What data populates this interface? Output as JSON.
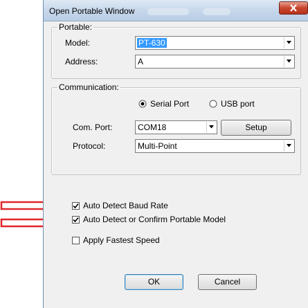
{
  "window": {
    "title": "Open Portable Window",
    "close_glyph": "x"
  },
  "portable": {
    "group_label": "Portable:",
    "model_label": "Model:",
    "model_value": "PT-630",
    "address_label": "Address:",
    "address_value": "A"
  },
  "communication": {
    "group_label": "Communication:",
    "serial_label": "Serial Port",
    "usb_label": "USB port",
    "serial_selected": true,
    "com_port_label": "Com. Port:",
    "com_port_value": "COM18",
    "setup_label": "Setup",
    "protocol_label": "Protocol:",
    "protocol_value": "Multi-Point"
  },
  "options": [
    {
      "label": "Auto Detect Baud Rate",
      "checked": true
    },
    {
      "label": "Auto Detect or Confirm Portable Model",
      "checked": true
    },
    {
      "label": "Apply Fastest Speed",
      "checked": false
    }
  ],
  "buttons": {
    "ok_label": "OK",
    "cancel_label": "Cancel"
  },
  "colors": {
    "annotation_arrow": "#e0262b",
    "selection": "#3399ff"
  }
}
